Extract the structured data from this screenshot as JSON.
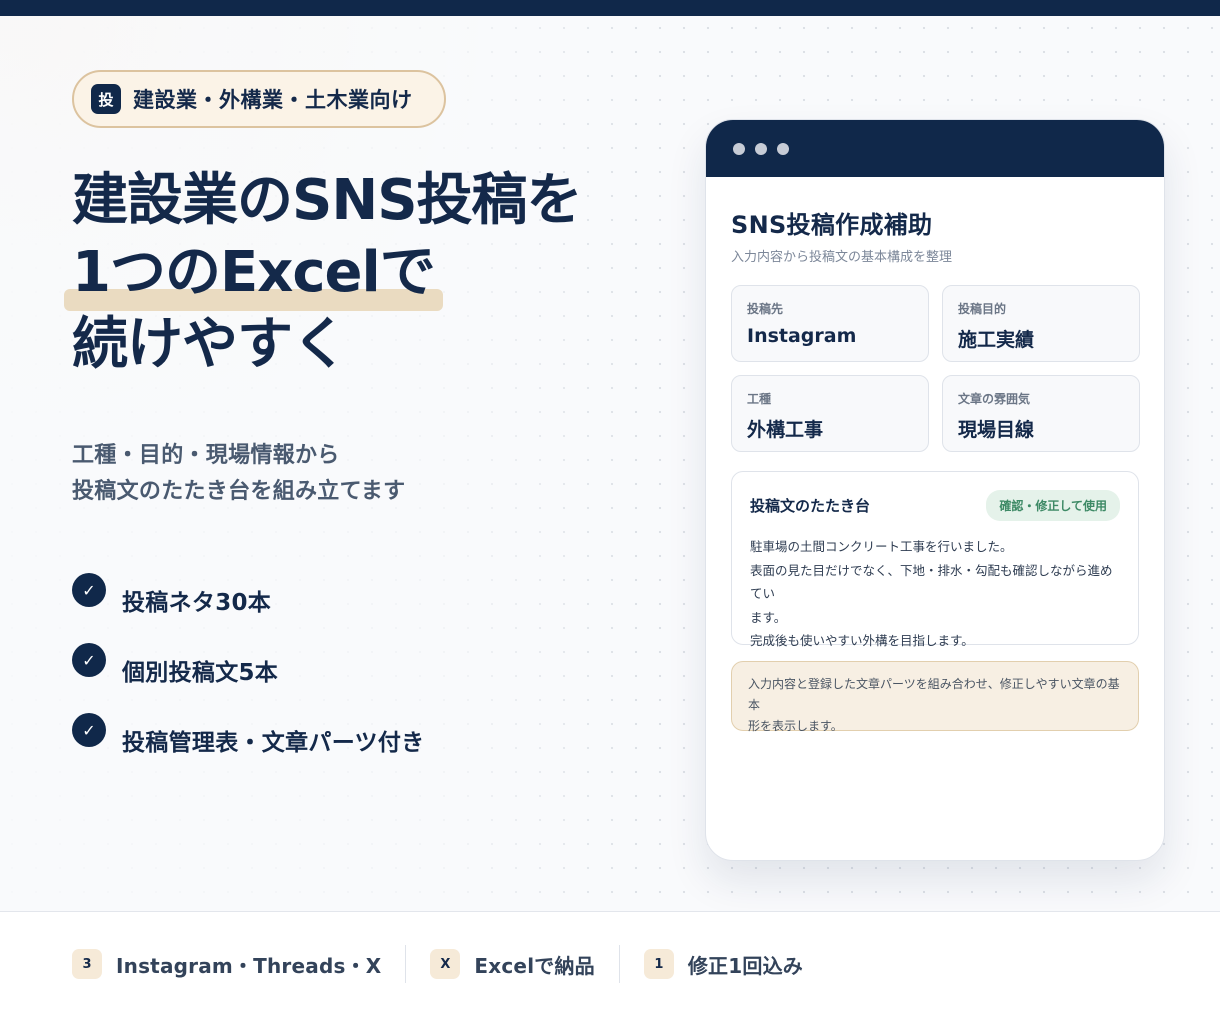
{
  "badge": {
    "icon_text": "投",
    "text": "建設業・外構業・土木業向け"
  },
  "headline": {
    "line1": "建設業のSNS投稿を",
    "line2": "1つのExcelで",
    "line3": "続けやすく"
  },
  "subtext": {
    "line1": "工種・目的・現場情報から",
    "line2": "投稿文のたたき台を組み立てます"
  },
  "features": [
    {
      "label": "投稿ネタ30本"
    },
    {
      "label": "個別投稿文5本"
    },
    {
      "label": "投稿管理表・文章パーツ付き"
    }
  ],
  "window": {
    "title": "SNS投稿作成補助",
    "subtitle": "入力内容から投稿文の基本構成を整理",
    "fields": [
      {
        "label": "投稿先",
        "value": "Instagram"
      },
      {
        "label": "投稿目的",
        "value": "施工実績"
      },
      {
        "label": "工種",
        "value": "外構工事"
      },
      {
        "label": "文章の雰囲気",
        "value": "現場目線"
      }
    ],
    "draft": {
      "title": "投稿文のたたき台",
      "pill": "確認・修正して使用",
      "lines": [
        "駐車場の土間コンクリート工事を行いました。",
        "表面の見た目だけでなく、下地・排水・勾配も確認しながら進めてい",
        "ます。",
        "完成後も使いやすい外構を目指します。"
      ]
    },
    "note": {
      "line1": "入力内容と登録した文章パーツを組み合わせ、修正しやすい文章の基本",
      "line2": "形を表示します。"
    }
  },
  "footer": [
    {
      "badge": "3",
      "label": "Instagram・Threads・X"
    },
    {
      "badge": "X",
      "label": "Excelで納品"
    },
    {
      "badge": "1",
      "label": "修正1回込み"
    }
  ],
  "colors": {
    "navy": "#10284a",
    "accent_beige": "#eadbc1",
    "pill_green": "#3e8a66"
  }
}
